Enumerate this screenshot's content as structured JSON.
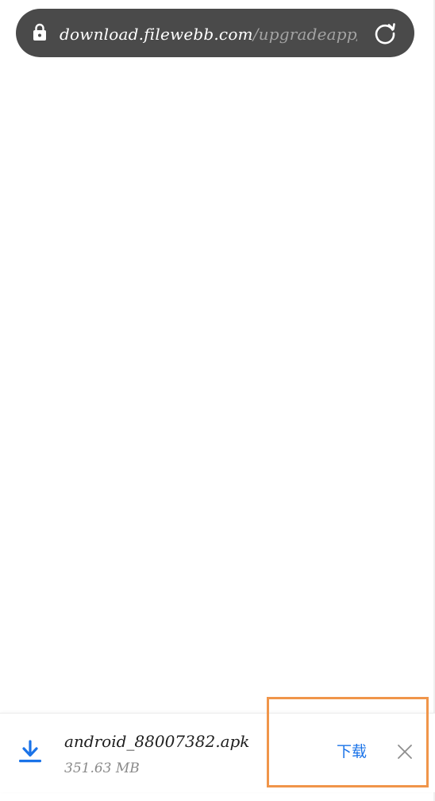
{
  "browser": {
    "url_host": "download.filewebb.com",
    "url_path": "/upgradeapp/andro",
    "lock_icon": "lock-icon",
    "reload_icon": "reload-icon"
  },
  "download": {
    "file_name": "android_88007382.apk",
    "file_size": "351.63 MB",
    "action_label": "下载",
    "download_icon": "download-icon",
    "close_icon": "close-icon",
    "accent_color": "#1a73e8"
  },
  "highlight": {
    "color": "#f0954a"
  }
}
